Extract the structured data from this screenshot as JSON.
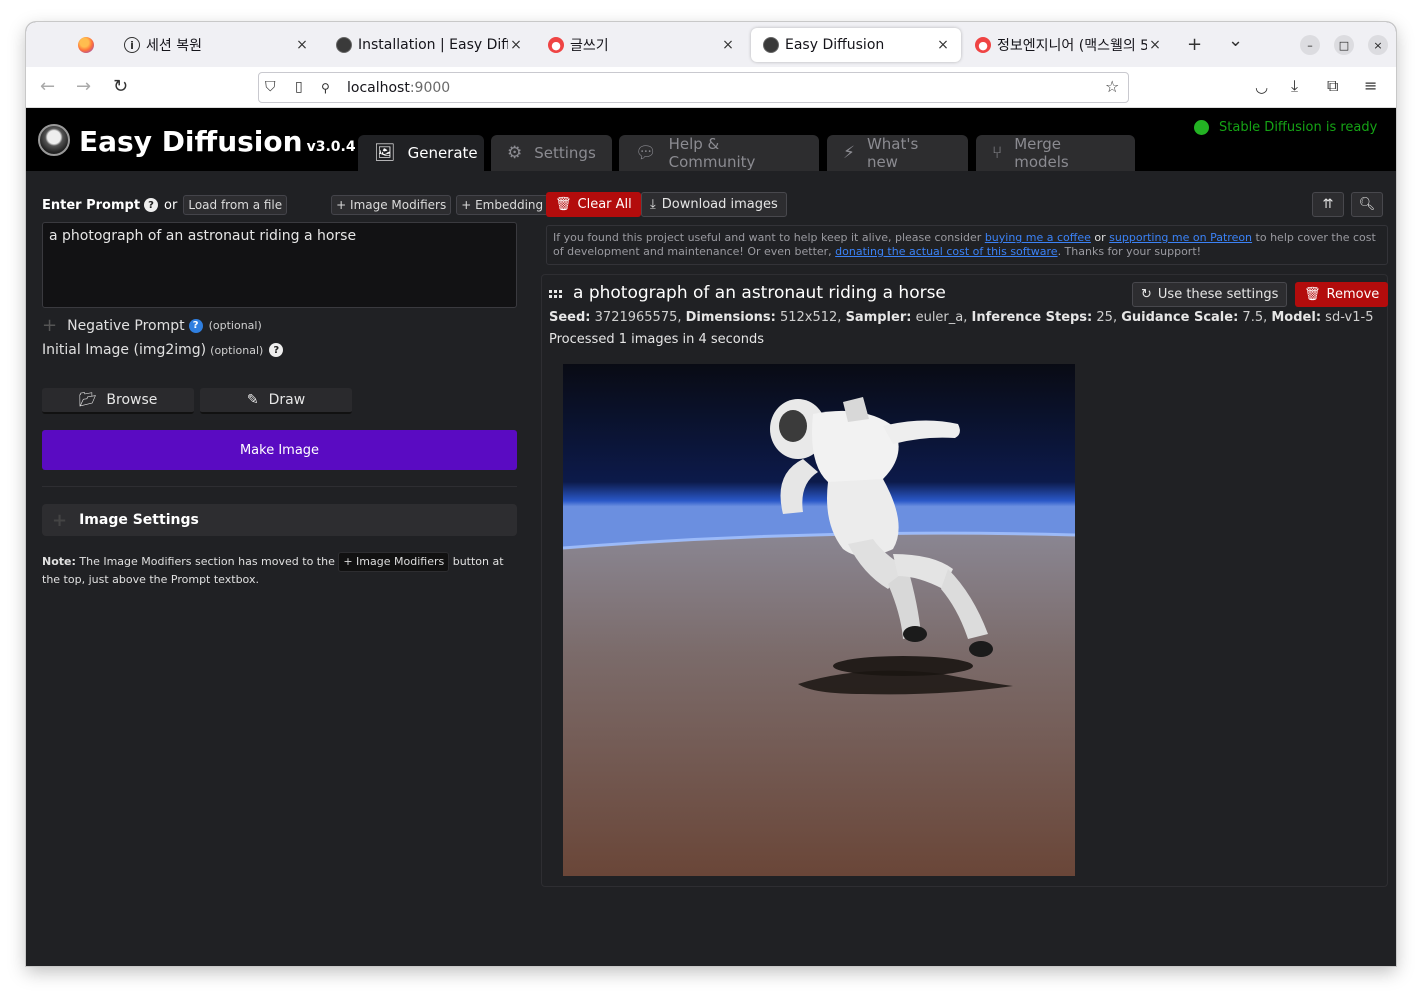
{
  "browser": {
    "tabs": [
      {
        "label": "세션 복원",
        "icon": "info-icon"
      },
      {
        "label": "Installation | Easy Diffu",
        "icon": "easy-diffusion-favicon"
      },
      {
        "label": "글쓰기",
        "icon": "tistory-favicon"
      },
      {
        "label": "Easy Diffusion",
        "icon": "easy-diffusion-favicon",
        "active": true
      },
      {
        "label": "정보엔지니어 (맥스웰의 5",
        "icon": "tistory-favicon"
      }
    ],
    "tab_close_glyph": "×",
    "new_tab_glyph": "+",
    "list_tabs_glyph": "⌄",
    "url_host": "localhost",
    "url_port": ":9000"
  },
  "app": {
    "title": "Easy Diffusion",
    "version": "v3.0.4",
    "tabs": [
      {
        "label": "Generate",
        "icon": "image-icon",
        "active": true
      },
      {
        "label": "Settings",
        "icon": "gear-icon"
      },
      {
        "label": "Help & Community",
        "icon": "comments-icon"
      },
      {
        "label": "What's new",
        "icon": "bolt-icon"
      },
      {
        "label": "Merge models",
        "icon": "merge-icon"
      }
    ],
    "status_text": "Stable Diffusion is ready",
    "status_color": "#23b223",
    "accent_color": "#5a0bc2"
  },
  "left": {
    "enter_prompt": "Enter Prompt",
    "or": "or",
    "load_from_file": "Load from a file",
    "image_modifiers": "+ Image Modifiers",
    "embedding": "+ Embedding",
    "prompt_value": "a photograph of an astronaut riding a horse",
    "negative_prompt": "Negative Prompt",
    "optional": "(optional)",
    "initial_image": "Initial Image (img2img)",
    "browse": "Browse",
    "draw": "Draw",
    "make_image": "Make Image",
    "image_settings": "Image Settings",
    "note_label": "Note:",
    "note_text_1": " The Image Modifiers section has moved to the ",
    "note_button": "+ Image Modifiers",
    "note_text_2": " button at the top, just above the Prompt textbox."
  },
  "right": {
    "clear_all": "Clear All",
    "download_images": "Download images",
    "support": {
      "t1": "If you found this project useful and want to help keep it alive, please consider ",
      "l1": "buying me a coffee",
      "t2": "or",
      "l2": "supporting me on Patreon",
      "t3": " to help cover the cost of development and maintenance! Or even better, ",
      "l3": "donating the actual cost of this software",
      "t4": ". Thanks for your support!"
    },
    "result": {
      "title": "a photograph of an astronaut riding a horse",
      "use_settings": "Use these settings",
      "remove": "Remove",
      "seed_label": "Seed:",
      "seed": "3721965575",
      "dim_label": "Dimensions:",
      "dimensions": "512x512",
      "sampler_label": "Sampler:",
      "sampler": "euler_a",
      "steps_label": "Inference Steps:",
      "steps": "25",
      "guidance_label": "Guidance Scale:",
      "guidance": "7.5",
      "model_label": "Model:",
      "model": "sd-v1-5",
      "processed": "Processed 1 images in 4 seconds"
    }
  }
}
